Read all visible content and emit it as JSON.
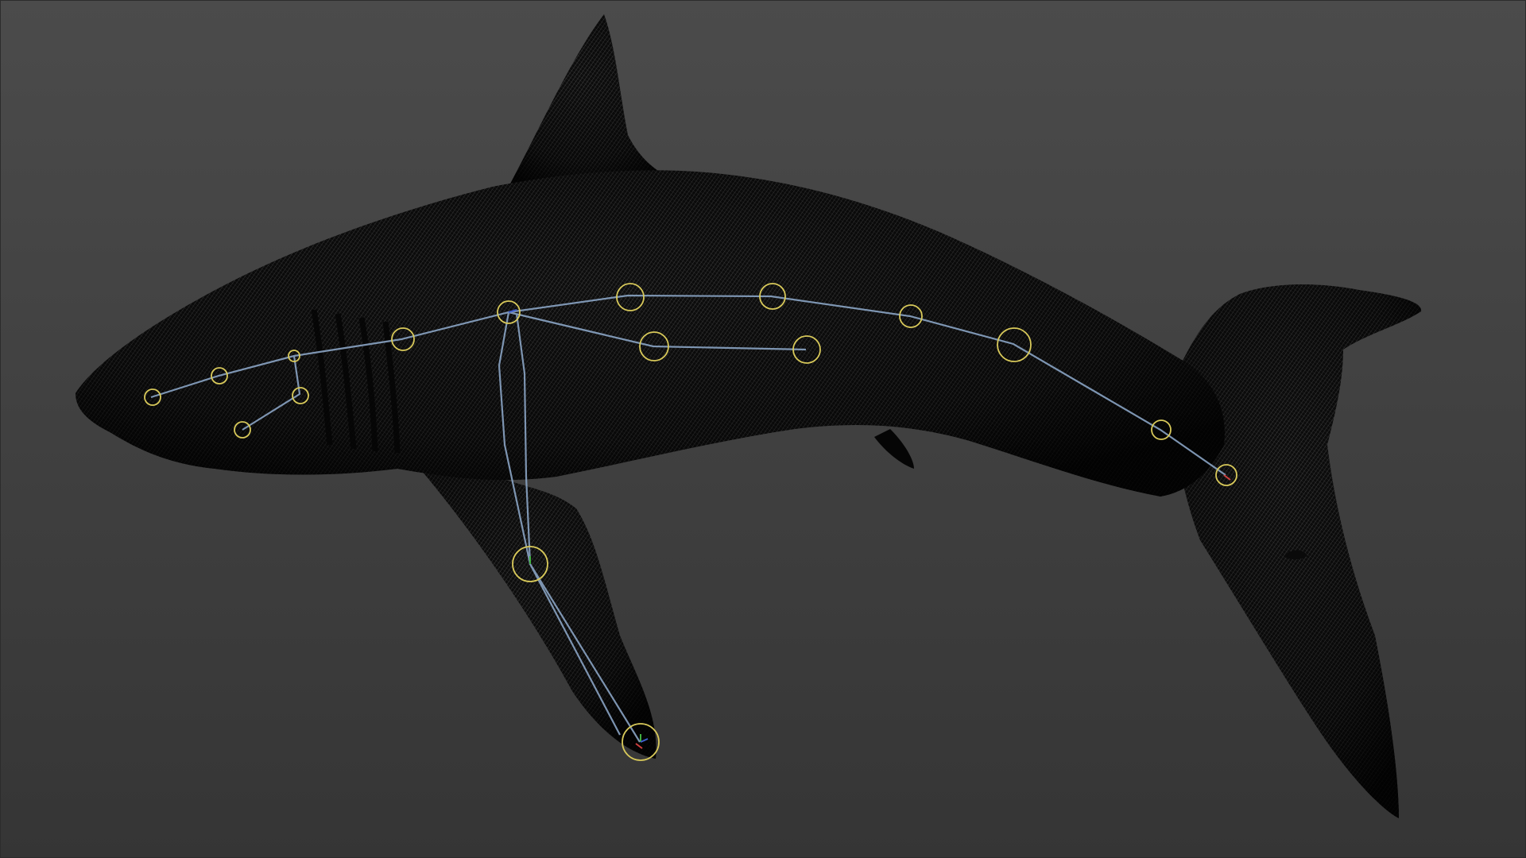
{
  "viewport": {
    "background_top": "#4b4b4b",
    "background_bottom": "#353535"
  },
  "model": {
    "name": "shark-mesh",
    "style": "wireframe",
    "mesh_color": "#0a0a0a",
    "wire_highlight": "#cfcfcf"
  },
  "rig": {
    "bone_color": "#8aa4c4",
    "joint_ring_color": "#d8c95a",
    "axis_colors": [
      "#d04040",
      "#40b040",
      "#4060d0"
    ]
  }
}
